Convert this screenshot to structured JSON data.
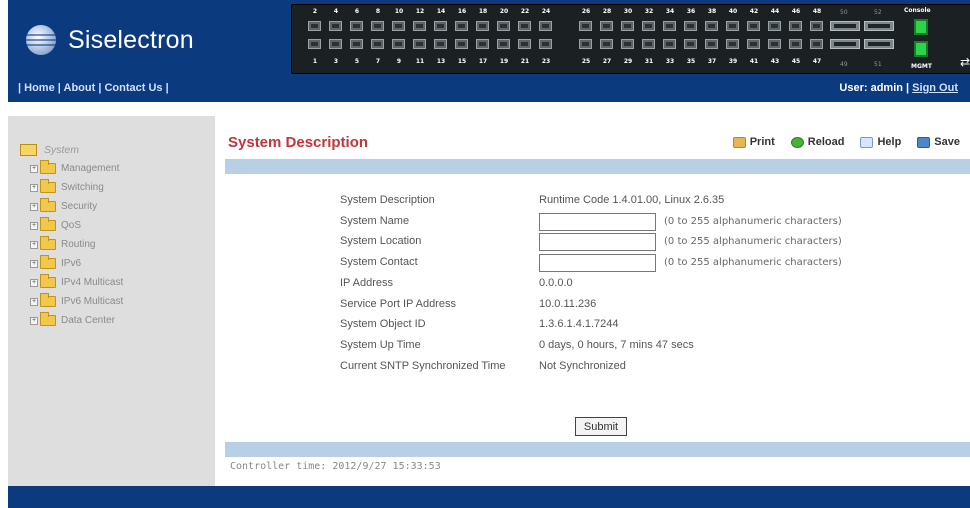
{
  "brand": {
    "name": "Siselectron"
  },
  "nav": {
    "left_bracket": "|",
    "home": "Home",
    "about": "About",
    "contact": "Contact Us",
    "sep": "|",
    "right_bracket": "|"
  },
  "user": {
    "label": "User: admin",
    "sep": "|",
    "signout": "Sign Out"
  },
  "switch": {
    "top_numbers": [
      "2",
      "4",
      "6",
      "8",
      "10",
      "12",
      "14",
      "16",
      "18",
      "20",
      "22",
      "24",
      "26",
      "28",
      "30",
      "32",
      "34",
      "36",
      "38",
      "40",
      "42",
      "44",
      "46",
      "48"
    ],
    "bottom_numbers": [
      "1",
      "3",
      "5",
      "7",
      "9",
      "11",
      "13",
      "15",
      "17",
      "19",
      "21",
      "23",
      "25",
      "27",
      "29",
      "31",
      "33",
      "35",
      "37",
      "39",
      "41",
      "43",
      "45",
      "47"
    ],
    "sfp_top": [
      "50",
      "52"
    ],
    "sfp_bottom": [
      "49",
      "51"
    ],
    "console_label": "Console",
    "mgmt_label": "MGMT"
  },
  "sidebar": {
    "root": "System",
    "items": [
      {
        "label": "Management"
      },
      {
        "label": "Switching"
      },
      {
        "label": "Security"
      },
      {
        "label": "QoS"
      },
      {
        "label": "Routing"
      },
      {
        "label": "IPv6"
      },
      {
        "label": "IPv4 Multicast"
      },
      {
        "label": "IPv6 Multicast"
      },
      {
        "label": "Data Center"
      }
    ]
  },
  "page": {
    "title": "System Description",
    "actions": {
      "print": "Print",
      "reload": "Reload",
      "help": "Help",
      "save": "Save"
    },
    "fields": [
      {
        "label": "System Description",
        "value": "Runtime Code 1.4.01.00, Linux 2.6.35"
      },
      {
        "label": "System Name",
        "input": "",
        "hint": "(0 to 255 alphanumeric characters)"
      },
      {
        "label": "System Location",
        "input": "",
        "hint": "(0 to 255 alphanumeric characters)"
      },
      {
        "label": "System Contact",
        "input": "",
        "hint": "(0 to 255 alphanumeric characters)"
      },
      {
        "label": "IP Address",
        "value": "0.0.0.0"
      },
      {
        "label": "Service Port IP Address",
        "value": "10.0.11.236"
      },
      {
        "label": "System Object ID",
        "value": "1.3.6.1.4.1.7244"
      },
      {
        "label": "System Up Time",
        "value": "0 days, 0 hours, 7 mins 47 secs"
      },
      {
        "label": "Current SNTP Synchronized Time",
        "value": "Not Synchronized"
      }
    ],
    "submit": "Submit",
    "controller_time": "Controller time: 2012/9/27 15:33:53"
  }
}
